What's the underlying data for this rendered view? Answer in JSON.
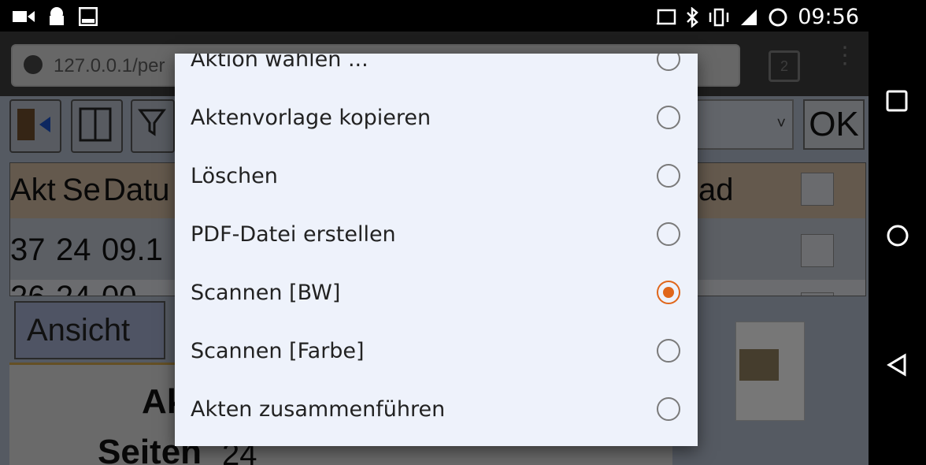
{
  "status_bar": {
    "time": "09:56",
    "left_icons": [
      "video-icon",
      "ghost-icon",
      "terminal-icon"
    ],
    "right_icons": [
      "cast-icon",
      "bluetooth-icon",
      "vibrate-icon",
      "signal-icon",
      "sync-icon"
    ]
  },
  "browser": {
    "url": "127.0.0.1/per",
    "tab_count": "2"
  },
  "page": {
    "ok_label": "OK",
    "table": {
      "headers": [
        "Akt",
        "Se",
        "Datu",
        "ad"
      ],
      "row1": [
        "37",
        "24",
        "09.1"
      ],
      "row2": [
        "26",
        "24",
        "00."
      ]
    },
    "ansicht_label": "Ansicht",
    "preview": {
      "title": "Ak",
      "seiten_label": "Seiten",
      "seiten_value": "24"
    }
  },
  "dialog": {
    "options": [
      {
        "label": "Aktion wählen ...",
        "selected": false
      },
      {
        "label": "Aktenvorlage kopieren",
        "selected": false
      },
      {
        "label": "Löschen",
        "selected": false
      },
      {
        "label": "PDF-Datei erstellen",
        "selected": false
      },
      {
        "label": "Scannen [BW]",
        "selected": true
      },
      {
        "label": "Scannen [Farbe]",
        "selected": false
      },
      {
        "label": "Akten zusammenführen",
        "selected": false
      }
    ]
  },
  "colors": {
    "accent": "#e0661a",
    "dialog_bg": "#eef2fb",
    "header_row": "#c9b39b"
  }
}
